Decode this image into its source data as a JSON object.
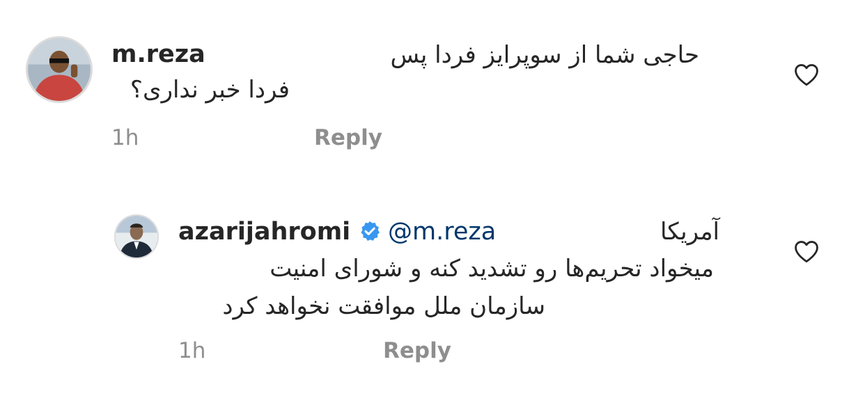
{
  "comments": [
    {
      "username": "m.reza",
      "text_line1": "حاجی شما از سوپرایز فردا پس",
      "text_line2": "فردا خبر نداری؟",
      "time": "1h",
      "reply_label": "Reply",
      "like_icon": "heart-outline-icon"
    },
    {
      "username": "azarijahromi",
      "verified_icon": "verified-badge-icon",
      "mention": "@m.reza",
      "text_line1": "آمریکا",
      "text_line2": "میخواد تحریم‌ها رو تشدید کنه و شورای امنیت",
      "text_line3": "سازمان ملل موافقت نخواهد کرد",
      "time": "1h",
      "reply_label": "Reply",
      "like_icon": "heart-outline-icon"
    }
  ],
  "colors": {
    "text": "#262626",
    "secondary": "#8e8e8e",
    "mention": "#00376b",
    "verified": "#3897f0"
  }
}
